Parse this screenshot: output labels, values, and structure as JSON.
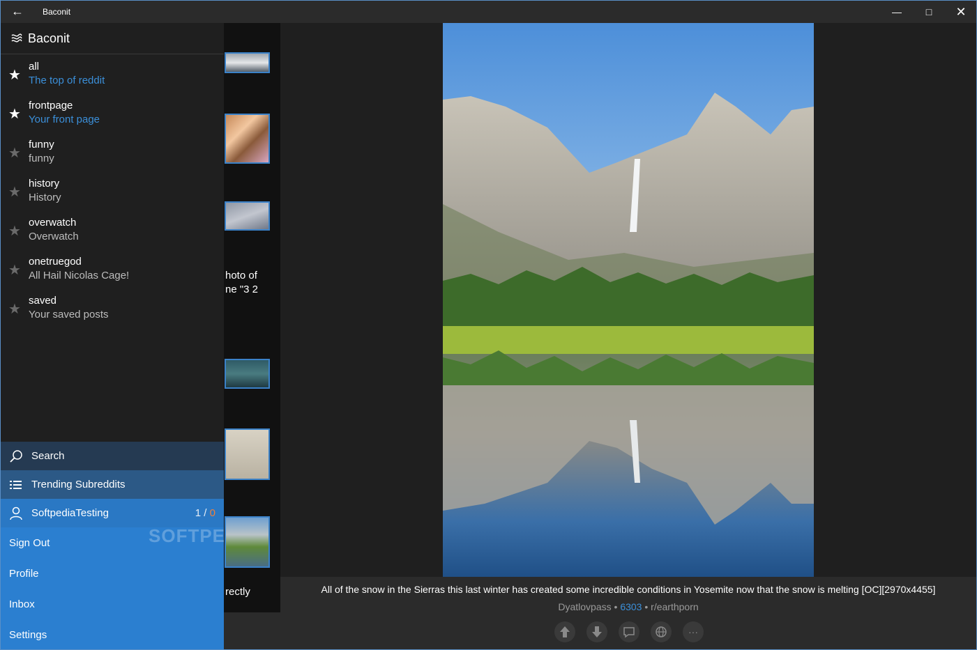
{
  "window": {
    "title": "Baconit",
    "back_icon": "back-arrow-icon",
    "minimize_icon": "minimize-icon",
    "maximize_icon": "maximize-icon",
    "close_icon": "close-icon"
  },
  "pane": {
    "app_name": "Baconit",
    "subreddits": [
      {
        "name": "all",
        "description": "The top of reddit",
        "favorite": true
      },
      {
        "name": "frontpage",
        "description": "Your front page",
        "favorite": true
      },
      {
        "name": "funny",
        "description": "funny",
        "favorite": false
      },
      {
        "name": "history",
        "description": "History",
        "favorite": false
      },
      {
        "name": "overwatch",
        "description": "Overwatch",
        "favorite": false
      },
      {
        "name": "onetruegod",
        "description": "All Hail Nicolas Cage!",
        "favorite": false
      },
      {
        "name": "saved",
        "description": "Your saved posts",
        "favorite": false
      }
    ],
    "search_label": "Search",
    "trending_label": "Trending Subreddits",
    "user": {
      "name": "SoftpediaTesting",
      "count_left": "1",
      "count_sep": " / ",
      "count_right": "0"
    },
    "account_menu": [
      "Sign Out",
      "Profile",
      "Inbox",
      "Settings"
    ]
  },
  "list_strip": {
    "text_lines_1": [
      "hoto of",
      "ne \"3 2"
    ],
    "text_line_2": "rectly"
  },
  "post": {
    "title": "All of the snow in the Sierras this last winter has created some incredible conditions in Yosemite now that the snow is melting [OC][2970x4455]",
    "author": "Dyatlovpass",
    "score": "6303",
    "subreddit": "r/earthporn",
    "separator": " • "
  },
  "watermark": "SOFTPE",
  "colors": {
    "accent": "#2b7fd0",
    "link": "#3b8fd9",
    "background": "#1f1f1f"
  }
}
